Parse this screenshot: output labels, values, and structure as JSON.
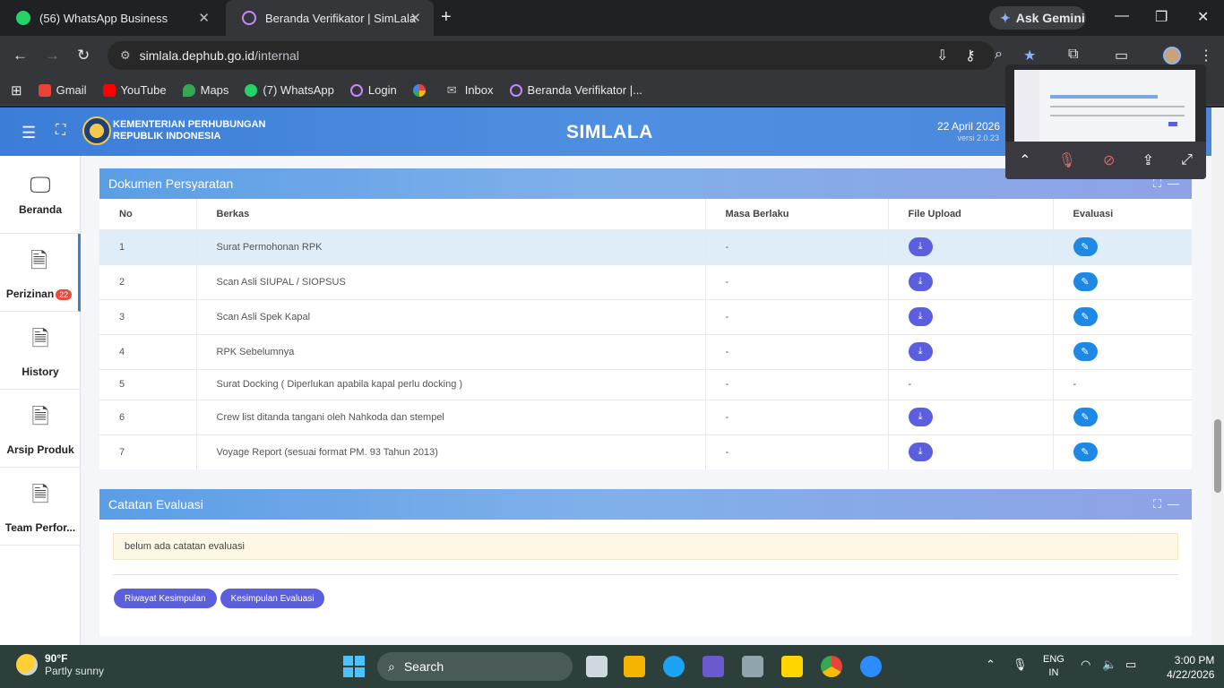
{
  "browser": {
    "tabs": [
      {
        "title": "(56) WhatsApp Business",
        "close": "✕"
      },
      {
        "title": "Beranda Verifikator | SimLala",
        "close": "✕"
      }
    ],
    "new_tab": "+",
    "gemini_label": "Ask Gemini",
    "url_host": "simlala.dephub.go.id",
    "url_path": "/internal",
    "bookmarks": [
      "Gmail",
      "YouTube",
      "Maps",
      "(7) WhatsApp",
      "Login",
      "",
      "Inbox",
      "Beranda Verifikator |..."
    ]
  },
  "header": {
    "ministry_line1": "KEMENTERIAN PERHUBUNGAN",
    "ministry_line2": "REPUBLIK INDONESIA",
    "title": "SIMLALA",
    "date": "22 April 2026",
    "version": "versi 2.0.23"
  },
  "sidebar": {
    "items": [
      {
        "label": "Beranda"
      },
      {
        "label": "Perizinan",
        "badge": "22"
      },
      {
        "label": "History"
      },
      {
        "label": "Arsip Produk"
      },
      {
        "label": "Team Perfor..."
      }
    ]
  },
  "documents": {
    "title": "Dokumen Persyaratan",
    "columns": [
      "No",
      "Berkas",
      "Masa Berlaku",
      "File Upload",
      "Evaluasi"
    ],
    "rows": [
      {
        "no": "1",
        "berkas": "Surat Permohonan RPK",
        "masa": "-"
      },
      {
        "no": "2",
        "berkas": "Scan Asli SIUPAL / SIOPSUS",
        "masa": "-"
      },
      {
        "no": "3",
        "berkas": "Scan Asli Spek Kapal",
        "masa": "-"
      },
      {
        "no": "4",
        "berkas": "RPK Sebelumnya",
        "masa": "-"
      },
      {
        "no": "5",
        "berkas": "Surat Docking ( Diperlukan apabila kapal perlu docking )",
        "masa": "-",
        "upload": "-",
        "eval": "-"
      },
      {
        "no": "6",
        "berkas": "Crew list ditanda tangani oleh Nahkoda dan stempel",
        "masa": "-"
      },
      {
        "no": "7",
        "berkas": "Voyage Report (sesuai format PM. 93 Tahun 2013)",
        "masa": "-"
      }
    ]
  },
  "evaluation": {
    "title": "Catatan Evaluasi",
    "note": "belum ada catatan evaluasi",
    "btn_history": "Riwayat Kesimpulan",
    "btn_conclusion": "Kesimpulan Evaluasi"
  },
  "taskbar": {
    "temp": "90°F",
    "weather": "Partly sunny",
    "search": "Search",
    "lang1": "ENG",
    "lang2": "IN",
    "time": "3:00 PM",
    "date": "4/22/2026"
  },
  "colors": {
    "accent": "#3b7dd8",
    "pill": "#5b5fdd",
    "eval_btn": "#1e88e5"
  }
}
